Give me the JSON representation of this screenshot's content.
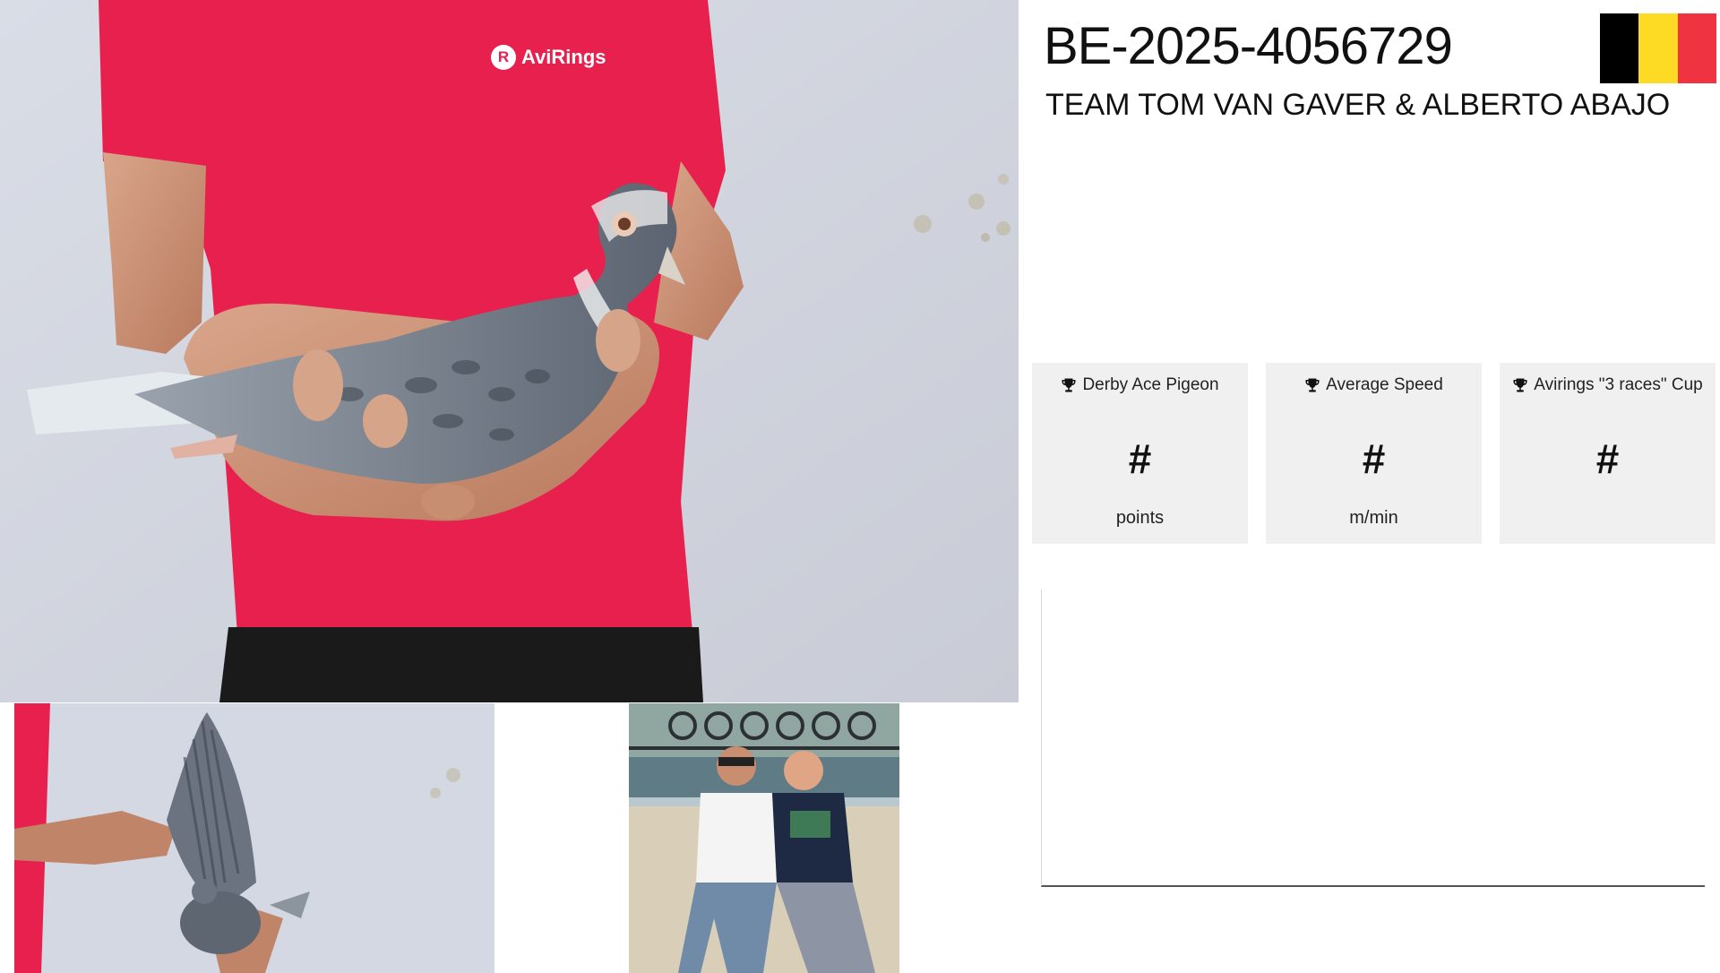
{
  "pigeon": {
    "ring_number": "BE-2025-4056729",
    "owner": "TEAM TOM VAN GAVER & ALBERTO ABAJO"
  },
  "flag": {
    "country": "Belgium",
    "colors": [
      "#000000",
      "#FDDA24",
      "#EF3340"
    ]
  },
  "photos": {
    "main_alt": "Pigeon held in hands",
    "shirt_logo_text": "AviRings",
    "wing_alt": "Pigeon wing spread",
    "team_alt": "Team photo"
  },
  "stats": [
    {
      "icon": "trophy-icon",
      "title": "Derby Ace Pigeon",
      "value": "#",
      "unit": "points"
    },
    {
      "icon": "trophy-icon",
      "title": "Average Speed",
      "value": "#",
      "unit": "m/min"
    },
    {
      "icon": "trophy-icon",
      "title": "Avirings \"3 races\" Cup",
      "value": "#",
      "unit": ""
    }
  ],
  "colors": {
    "card_bg": "#f0f0f0",
    "shirt": "#e8204e"
  }
}
